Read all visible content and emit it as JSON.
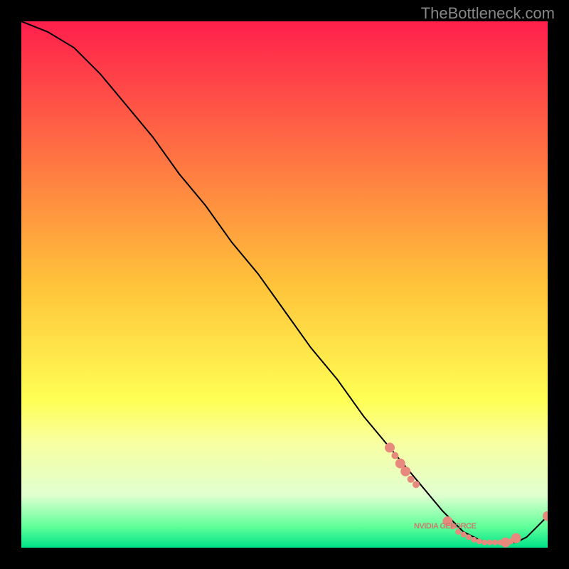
{
  "watermark": "TheBottleneck.com",
  "annotation_label": "NVIDIA GEFORCE",
  "chart_data": {
    "type": "line",
    "title": "",
    "xlabel": "",
    "ylabel": "",
    "xlim": [
      0,
      100
    ],
    "ylim": [
      0,
      100
    ],
    "background_gradient": [
      {
        "stop": 0.0,
        "color": "#ff1f4c"
      },
      {
        "stop": 0.5,
        "color": "#ffc33a"
      },
      {
        "stop": 0.72,
        "color": "#ffff55"
      },
      {
        "stop": 0.8,
        "color": "#f8ffa0"
      },
      {
        "stop": 0.9,
        "color": "#e0ffd0"
      },
      {
        "stop": 0.96,
        "color": "#60ff9a"
      },
      {
        "stop": 1.0,
        "color": "#00e388"
      }
    ],
    "series": [
      {
        "name": "bottleneck-curve",
        "color": "#000000",
        "x": [
          0,
          5,
          10,
          15,
          20,
          25,
          30,
          35,
          40,
          45,
          50,
          55,
          60,
          65,
          70,
          75,
          80,
          82,
          84,
          86,
          88,
          90,
          92,
          94,
          96,
          98,
          100
        ],
        "y": [
          100,
          98,
          95,
          90,
          84,
          78,
          71,
          65,
          58,
          52,
          45,
          38,
          32,
          25,
          19,
          13,
          7,
          5,
          3,
          2,
          1,
          1,
          1,
          1,
          2,
          4,
          6
        ]
      }
    ],
    "markers": {
      "color": "#e78a7d",
      "radius_large": 7,
      "radius_small": 4,
      "points": [
        {
          "x": 70,
          "y": 19,
          "r": 7
        },
        {
          "x": 71,
          "y": 17.5,
          "r": 5
        },
        {
          "x": 72,
          "y": 16,
          "r": 7
        },
        {
          "x": 73,
          "y": 14.5,
          "r": 7
        },
        {
          "x": 74,
          "y": 13,
          "r": 5
        },
        {
          "x": 75,
          "y": 12,
          "r": 5
        },
        {
          "x": 81,
          "y": 5,
          "r": 7
        },
        {
          "x": 82,
          "y": 4,
          "r": 4
        },
        {
          "x": 83,
          "y": 3,
          "r": 4
        },
        {
          "x": 84,
          "y": 2.5,
          "r": 4
        },
        {
          "x": 85,
          "y": 2,
          "r": 4
        },
        {
          "x": 86,
          "y": 1.5,
          "r": 4
        },
        {
          "x": 87,
          "y": 1.2,
          "r": 4
        },
        {
          "x": 88,
          "y": 1,
          "r": 4
        },
        {
          "x": 89,
          "y": 1,
          "r": 4
        },
        {
          "x": 90,
          "y": 1,
          "r": 4
        },
        {
          "x": 91,
          "y": 1,
          "r": 4
        },
        {
          "x": 92,
          "y": 1,
          "r": 7
        },
        {
          "x": 93,
          "y": 1.2,
          "r": 4
        },
        {
          "x": 94,
          "y": 1.8,
          "r": 7
        },
        {
          "x": 100,
          "y": 6,
          "r": 7
        }
      ]
    },
    "annotation": {
      "text": "NVIDIA GEFORCE",
      "x": 80,
      "y": 4
    }
  }
}
